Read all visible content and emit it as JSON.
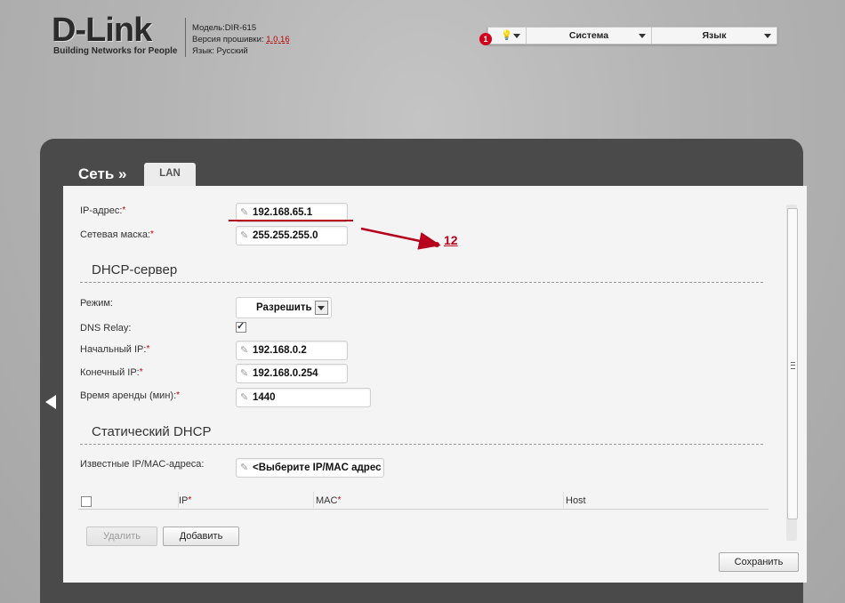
{
  "header": {
    "logo": "D-Link",
    "tagline": "Building Networks for People",
    "model": "Модель:DIR-615",
    "firmware_label": "Версия прошивки:",
    "firmware_version": "1.0.16",
    "language": "Язык: Русский"
  },
  "topbar": {
    "notifications_count": "1",
    "system_label": "Система",
    "language_label": "Язык"
  },
  "page": {
    "breadcrumb": "Сеть »",
    "tab_label": "LAN"
  },
  "lan": {
    "ip_label": "IP-адрес:",
    "ip_value": "192.168.65.1",
    "mask_label": "Сетевая маска:",
    "mask_value": "255.255.255.0"
  },
  "dhcp": {
    "section_title": "DHCP-сервер",
    "mode_label": "Режим:",
    "mode_value": "Разрешить",
    "relay_label": "DNS Relay:",
    "relay_checked": true,
    "start_label": "Начальный IP:",
    "start_value": "192.168.0.2",
    "end_label": "Конечный IP:",
    "end_value": "192.168.0.254",
    "lease_label": "Время аренды (мин):",
    "lease_value": "1440"
  },
  "static_dhcp": {
    "section_title": "Статический DHCP",
    "known_label": "Известные IP/MAC-адреса:",
    "known_value": "<Выберите IP/MAC адрес",
    "columns": [
      "IP",
      "MAC",
      "Host"
    ],
    "delete_label": "Удалить",
    "add_label": "Добавить"
  },
  "save_label": "Сохранить",
  "annotation": {
    "number": "12"
  },
  "colors": {
    "required": "#cc0000",
    "annotation": "#b7001e",
    "panel_dark": "#4a4a4a"
  }
}
